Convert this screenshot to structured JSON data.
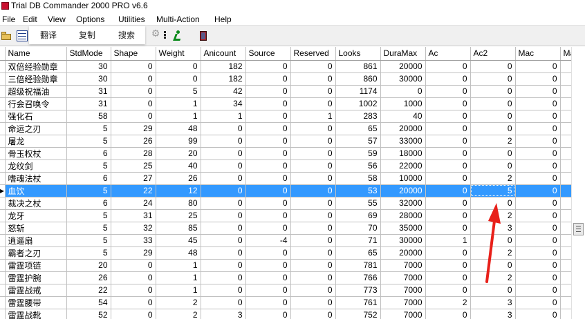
{
  "window": {
    "title": "Trial DB Commander 2000 PRO v6.6"
  },
  "menu": [
    "File",
    "Edit",
    "View",
    "Options",
    "Utilities",
    "Multi-Action",
    "Help"
  ],
  "popup": {
    "translate_label": "翻译",
    "copy_label": "复制",
    "search_label": "搜索"
  },
  "icons": {
    "open": "folder-icon",
    "table": "table-icon",
    "settings": "gear-icon",
    "more": "more-dots-icon",
    "run": "run-icon",
    "exit": "exit-door-icon"
  },
  "columns": [
    "Name",
    "StdMode",
    "Shape",
    "Weight",
    "Anicount",
    "Source",
    "Reserved",
    "Looks",
    "DuraMax",
    "Ac",
    "Ac2",
    "Mac",
    "Ma"
  ],
  "rows": [
    [
      "双倍经验勋章",
      "30",
      "0",
      "0",
      "182",
      "0",
      "0",
      "861",
      "20000",
      "0",
      "0",
      "0",
      ""
    ],
    [
      "三倍经验勋章",
      "30",
      "0",
      "0",
      "182",
      "0",
      "0",
      "860",
      "30000",
      "0",
      "0",
      "0",
      ""
    ],
    [
      "超级祝福油",
      "31",
      "0",
      "5",
      "42",
      "0",
      "0",
      "1174",
      "0",
      "0",
      "0",
      "0",
      ""
    ],
    [
      "行会召唤令",
      "31",
      "0",
      "1",
      "34",
      "0",
      "0",
      "1002",
      "1000",
      "0",
      "0",
      "0",
      ""
    ],
    [
      "强化石",
      "58",
      "0",
      "1",
      "1",
      "0",
      "1",
      "283",
      "40",
      "0",
      "0",
      "0",
      ""
    ],
    [
      "命运之刃",
      "5",
      "29",
      "48",
      "0",
      "0",
      "0",
      "65",
      "20000",
      "0",
      "0",
      "0",
      ""
    ],
    [
      "屠龙",
      "5",
      "26",
      "99",
      "0",
      "0",
      "0",
      "57",
      "33000",
      "0",
      "2",
      "0",
      ""
    ],
    [
      "骨玉权杖",
      "6",
      "28",
      "20",
      "0",
      "0",
      "0",
      "59",
      "18000",
      "0",
      "0",
      "0",
      ""
    ],
    [
      "龙纹剑",
      "5",
      "25",
      "40",
      "0",
      "0",
      "0",
      "56",
      "22000",
      "0",
      "0",
      "0",
      ""
    ],
    [
      "嗜魂法杖",
      "6",
      "27",
      "26",
      "0",
      "0",
      "0",
      "58",
      "10000",
      "0",
      "2",
      "0",
      ""
    ],
    [
      "血饮",
      "5",
      "22",
      "12",
      "0",
      "0",
      "0",
      "53",
      "20000",
      "0",
      "5",
      "0",
      ""
    ],
    [
      "裁决之杖",
      "6",
      "24",
      "80",
      "0",
      "0",
      "0",
      "55",
      "32000",
      "0",
      "0",
      "0",
      ""
    ],
    [
      "龙牙",
      "5",
      "31",
      "25",
      "0",
      "0",
      "0",
      "69",
      "28000",
      "0",
      "2",
      "0",
      ""
    ],
    [
      "怒斩",
      "5",
      "32",
      "85",
      "0",
      "0",
      "0",
      "70",
      "35000",
      "0",
      "3",
      "0",
      ""
    ],
    [
      "逍遥扇",
      "5",
      "33",
      "45",
      "0",
      "-4",
      "0",
      "71",
      "30000",
      "1",
      "0",
      "0",
      ""
    ],
    [
      "霸者之刃",
      "5",
      "29",
      "48",
      "0",
      "0",
      "0",
      "65",
      "20000",
      "0",
      "2",
      "0",
      ""
    ],
    [
      "雷霆项链",
      "20",
      "0",
      "1",
      "0",
      "0",
      "0",
      "781",
      "7000",
      "0",
      "0",
      "0",
      ""
    ],
    [
      "雷霆护腕",
      "26",
      "0",
      "1",
      "0",
      "0",
      "0",
      "766",
      "7000",
      "0",
      "2",
      "0",
      ""
    ],
    [
      "雷霆战戒",
      "22",
      "0",
      "1",
      "0",
      "0",
      "0",
      "773",
      "7000",
      "0",
      "0",
      "0",
      ""
    ],
    [
      "雷霆腰带",
      "54",
      "0",
      "2",
      "0",
      "0",
      "0",
      "761",
      "7000",
      "2",
      "3",
      "0",
      ""
    ],
    [
      "雷霆战靴",
      "52",
      "0",
      "2",
      "3",
      "0",
      "0",
      "752",
      "7000",
      "0",
      "3",
      "0",
      ""
    ]
  ],
  "selected_row_index": 10,
  "colors": {
    "selection": "#3399ff",
    "annotation_arrow": "#e8201a"
  }
}
